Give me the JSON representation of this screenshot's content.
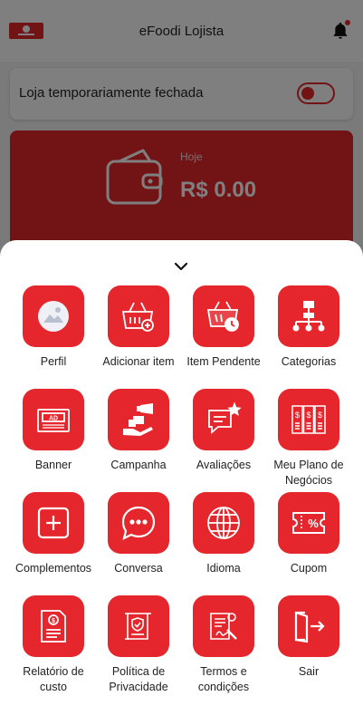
{
  "app": {
    "title": "eFoodi Lojista",
    "brand_color": "#e5262c"
  },
  "store_status": {
    "label": "Loja temporariamente fechada",
    "toggle_on": false
  },
  "earnings": {
    "period_label": "Hoje",
    "amount": "R$ 0.00"
  },
  "menu": {
    "items": [
      {
        "label": "Perfil",
        "icon": "image-icon"
      },
      {
        "label": "Adicionar item",
        "icon": "add-basket-icon"
      },
      {
        "label": "Item Pendente",
        "icon": "pending-basket-icon"
      },
      {
        "label": "Categorias",
        "icon": "hierarchy-icon"
      },
      {
        "label": "Banner",
        "icon": "ad-banner-icon"
      },
      {
        "label": "Campanha",
        "icon": "campaign-icon"
      },
      {
        "label": "Avaliações",
        "icon": "review-icon"
      },
      {
        "label": "Meu Plano de Negócios",
        "icon": "business-plan-icon"
      },
      {
        "label": "Complementos",
        "icon": "plus-square-icon"
      },
      {
        "label": "Conversa",
        "icon": "chat-icon"
      },
      {
        "label": "Idioma",
        "icon": "globe-icon"
      },
      {
        "label": "Cupom",
        "icon": "coupon-icon"
      },
      {
        "label": "Relatório de custo",
        "icon": "expense-report-icon"
      },
      {
        "label": "Política de Privacidade",
        "icon": "privacy-policy-icon"
      },
      {
        "label": "Termos e condições",
        "icon": "terms-icon"
      },
      {
        "label": "Sair",
        "icon": "logout-icon"
      }
    ]
  }
}
